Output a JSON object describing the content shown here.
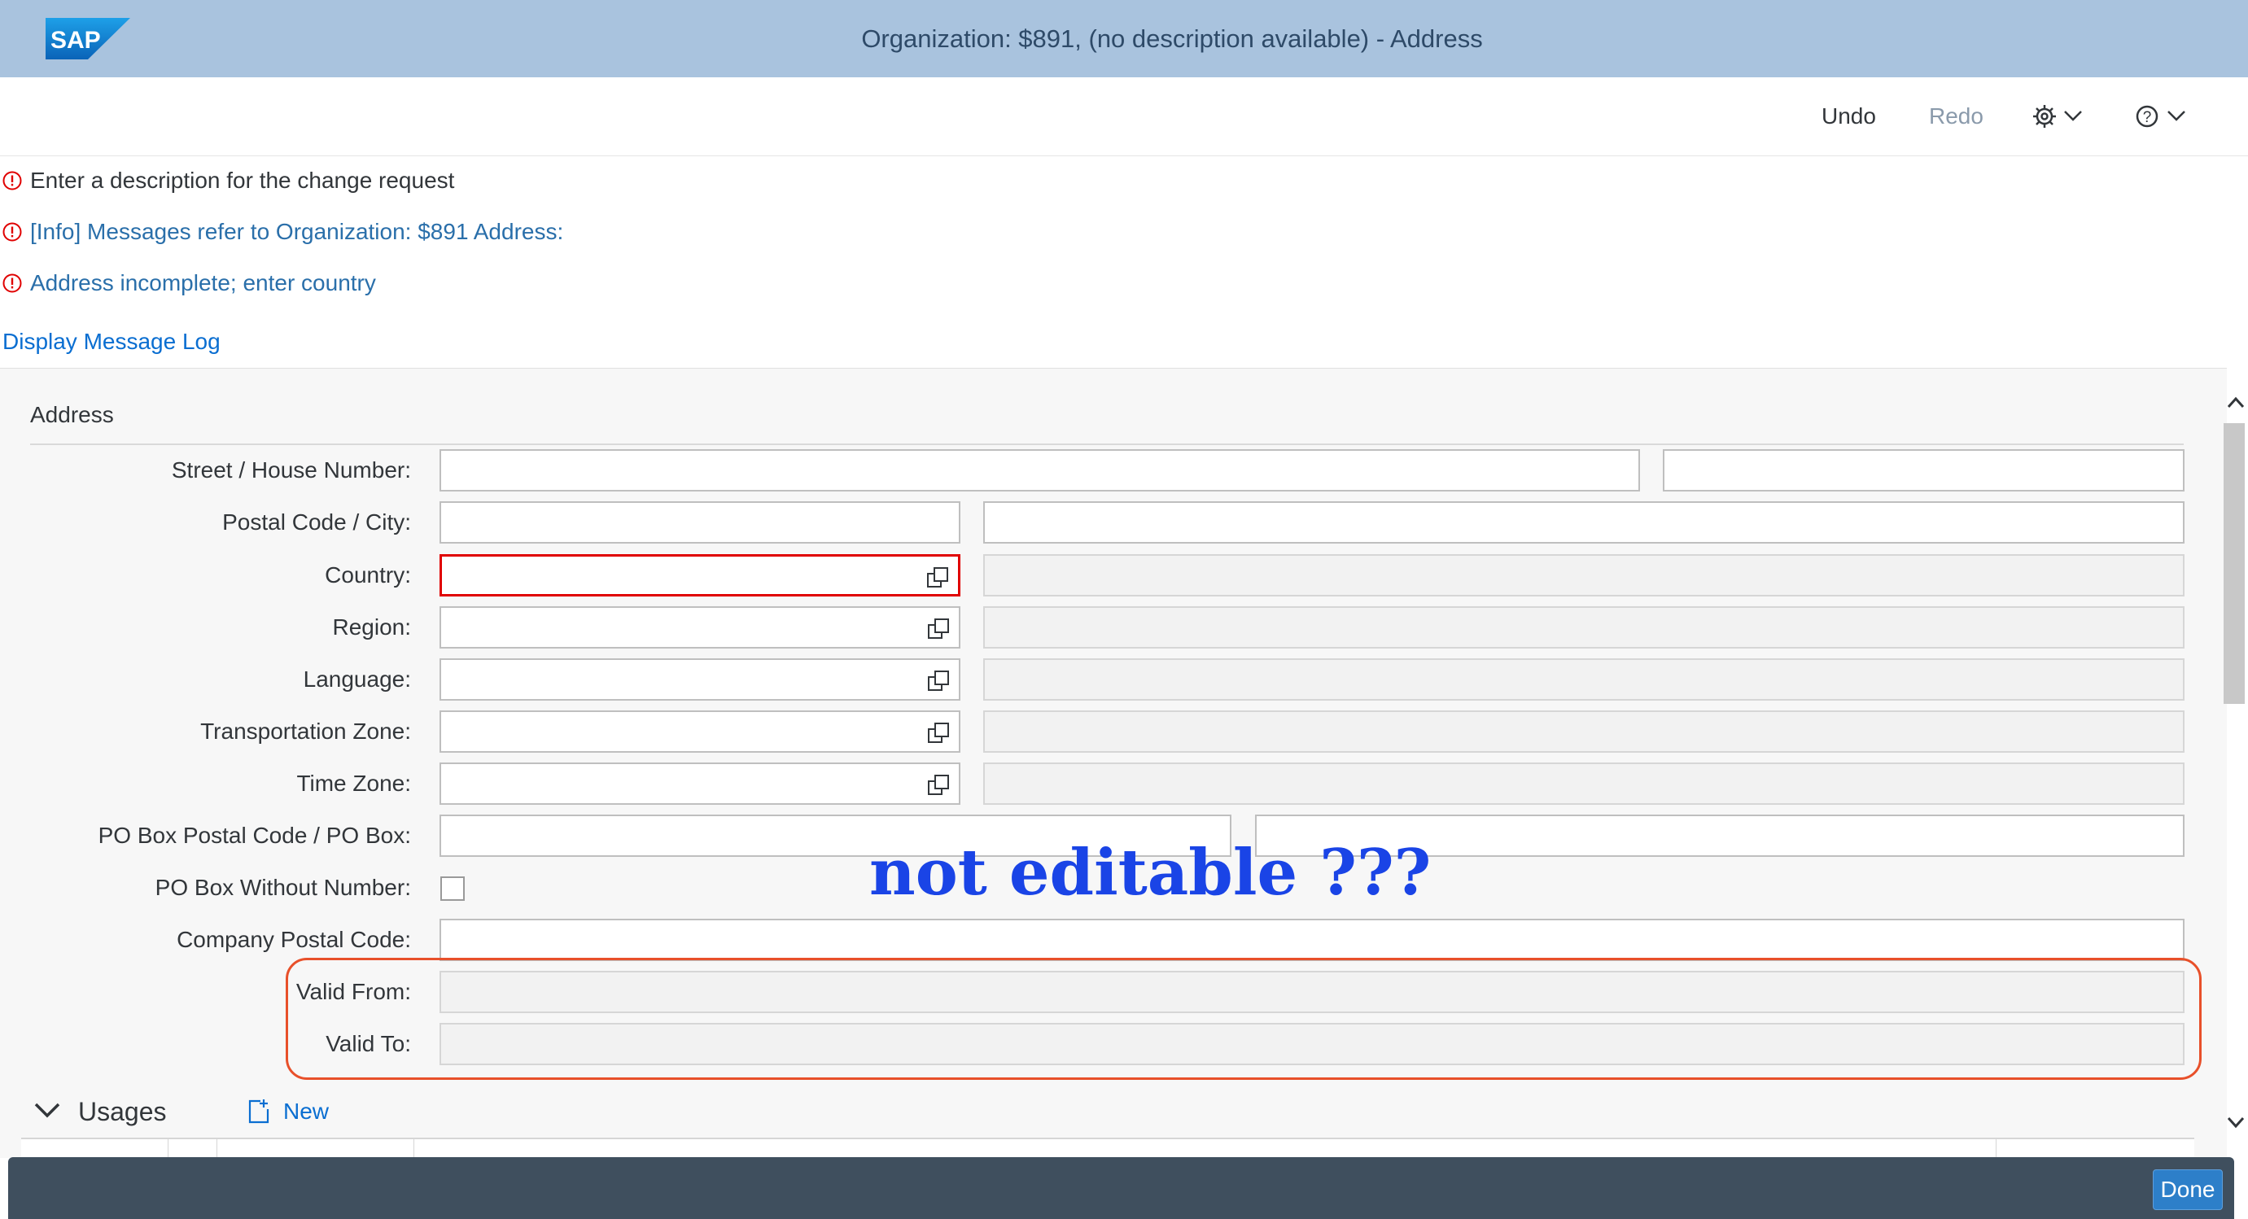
{
  "shell": {
    "logo_text": "SAP",
    "title": "Organization: $891, (no description available) - Address"
  },
  "toolbar": {
    "undo": "Undo",
    "redo": "Redo",
    "settings_icon": "gear-icon",
    "help_icon": "question-icon"
  },
  "messages": [
    {
      "text": "Enter a description for the change request",
      "type": "error"
    },
    {
      "text": "[Info] Messages refer to Organization: $891 Address:",
      "type": "error"
    },
    {
      "text": "Address incomplete; enter country",
      "type": "error"
    }
  ],
  "message_log_link": "Display Message Log",
  "address": {
    "section_title": "Address",
    "fields": {
      "street": "Street / House Number:",
      "postal": "Postal Code / City:",
      "country": "Country:",
      "region": "Region:",
      "language": "Language:",
      "transport": "Transportation Zone:",
      "timezone": "Time Zone:",
      "pobox": "PO Box Postal Code / PO Box:",
      "pobox_wo": "PO Box Without Number:",
      "company_postal": "Company Postal Code:",
      "valid_from": "Valid From:",
      "valid_to": "Valid To:"
    }
  },
  "annotation": "not editable ???",
  "usages": {
    "title": "Usages",
    "new_label": "New"
  },
  "footer": {
    "done": "Done"
  },
  "colors": {
    "shell_bg": "#a9c3de",
    "error_red": "#e00000",
    "link_blue": "#0a6ed1",
    "annotation_blue": "#1a44e6",
    "highlight_orange": "#e8502a",
    "footer_bg": "#3f4f5e"
  }
}
